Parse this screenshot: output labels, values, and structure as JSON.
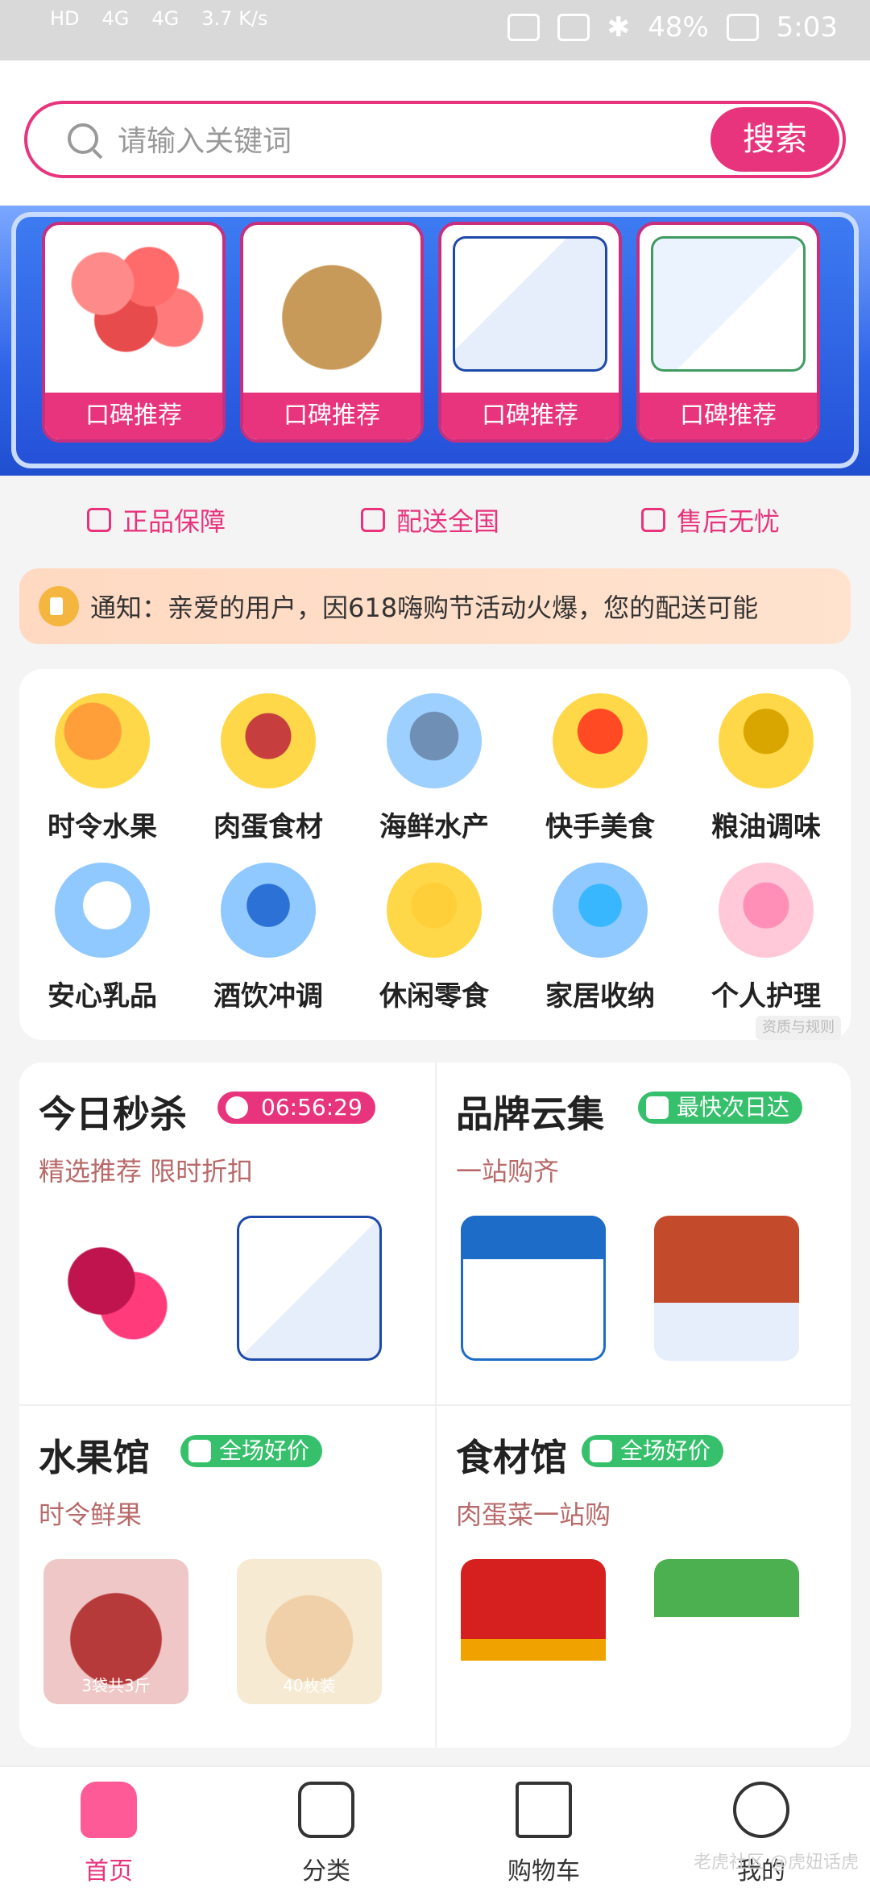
{
  "status_bar": {
    "left_labels": [
      "HD",
      "4G",
      "4G",
      "3.7\nK/s"
    ],
    "battery": "48%",
    "time": "5:03"
  },
  "search": {
    "placeholder": "请输入关键词",
    "button_label": "搜索"
  },
  "banner": {
    "products": [
      {
        "tag": "口碑推荐",
        "icon": "apple-image"
      },
      {
        "tag": "口碑推荐",
        "icon": "kiwi-image"
      },
      {
        "tag": "口碑推荐",
        "icon": "milk-box-image"
      },
      {
        "tag": "口碑推荐",
        "icon": "milk-case-image"
      }
    ]
  },
  "guarantees": [
    {
      "label": "正品保障",
      "icon": "genuine-icon"
    },
    {
      "label": "配送全国",
      "icon": "truck-icon"
    },
    {
      "label": "售后无忧",
      "icon": "headset-icon"
    }
  ],
  "notice": {
    "text": "通知：亲爱的用户，因618嗨购节活动火爆，您的配送可能"
  },
  "categories": [
    {
      "label": "时令水果"
    },
    {
      "label": "肉蛋食材"
    },
    {
      "label": "海鲜水产"
    },
    {
      "label": "快手美食"
    },
    {
      "label": "粮油调味"
    },
    {
      "label": "安心乳品"
    },
    {
      "label": "酒饮冲调"
    },
    {
      "label": "休闲零食"
    },
    {
      "label": "家居收纳"
    },
    {
      "label": "个人护理"
    }
  ],
  "rules_label": "资质与规则",
  "promo": {
    "flash": {
      "title": "今日秒杀",
      "timer": "06:56:29",
      "subtitle": "精选推荐 限时折扣"
    },
    "brand": {
      "title": "品牌云集",
      "badge": "最快次日达",
      "subtitle": "一站购齐"
    },
    "fruit": {
      "title": "水果馆",
      "badge": "全场好价",
      "subtitle": "时令鲜果",
      "captions": [
        "3袋共3斤",
        "40枚装"
      ]
    },
    "food": {
      "title": "食材馆",
      "badge": "全场好价",
      "subtitle": "肉蛋菜一站购"
    }
  },
  "tabs": [
    {
      "label": "首页",
      "active": true
    },
    {
      "label": "分类",
      "active": false
    },
    {
      "label": "购物车",
      "active": false
    },
    {
      "label": "我的",
      "active": false
    }
  ],
  "watermark": "老虎社区 @虎妞话虎",
  "colors": {
    "accent": "#e8347d",
    "banner_blue": "#2f64e8",
    "notice_bg": "#ffe3cf",
    "green_badge": "#36c06b"
  }
}
